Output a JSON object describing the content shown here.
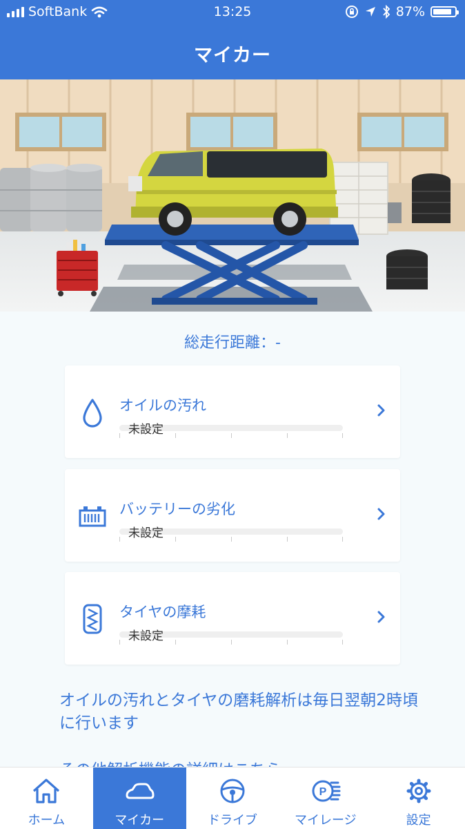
{
  "status_bar": {
    "carrier": "SoftBank",
    "time": "13:25",
    "battery": "87%",
    "icons": [
      "signal-bars-icon",
      "wifi-icon",
      "rotation-lock-icon",
      "location-arrow-icon",
      "bluetooth-icon",
      "battery-icon"
    ]
  },
  "header": {
    "title": "マイカー"
  },
  "summary": {
    "total_distance": "総走行距離：-"
  },
  "cards": [
    {
      "icon": "oil-drop-icon",
      "label": "オイルの汚れ",
      "value": "未設定"
    },
    {
      "icon": "battery-icon",
      "label": "バッテリーの劣化",
      "value": "未設定"
    },
    {
      "icon": "tire-icon",
      "label": "タイヤの摩耗",
      "value": "未設定"
    }
  ],
  "note": "オイルの汚れとタイヤの磨耗解析は毎日翌朝2時頃に行います",
  "more_link": "その他解析機能の詳細はこちら",
  "tabs": [
    {
      "label": "ホーム",
      "icon": "home-icon",
      "active": false
    },
    {
      "label": "マイカー",
      "icon": "car-icon",
      "active": true
    },
    {
      "label": "ドライブ",
      "icon": "steering-wheel-icon",
      "active": false
    },
    {
      "label": "マイレージ",
      "icon": "parking-coins-icon",
      "active": false
    },
    {
      "label": "設定",
      "icon": "gear-icon",
      "active": false
    }
  ],
  "colors": {
    "accent": "#3b78d8",
    "background": "#f5fafc",
    "car": "#d4d640"
  }
}
